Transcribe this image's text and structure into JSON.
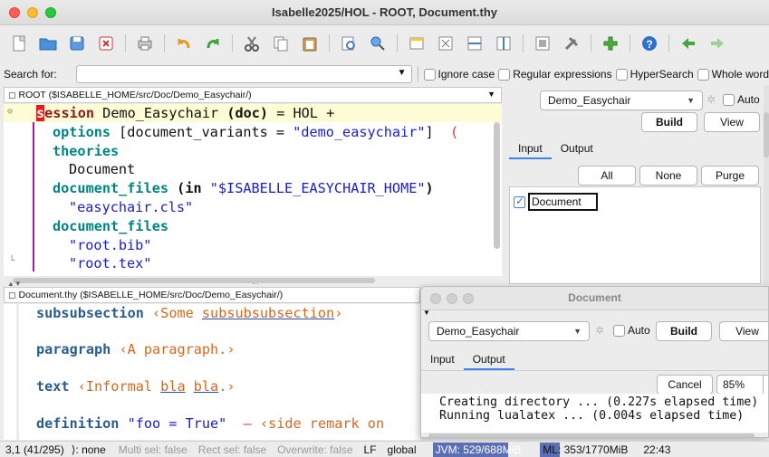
{
  "window": {
    "title": "Isabelle2025/HOL - ROOT, Document.thy"
  },
  "toolbar": {
    "icons": [
      "new-file-icon",
      "open-folder-icon",
      "save-icon",
      "close-icon",
      "print-icon",
      "undo-icon",
      "redo-icon",
      "cut-icon",
      "copy-icon",
      "paste-icon",
      "find-icon",
      "replace-icon",
      "new-view-icon",
      "split-icon",
      "split-horizontal-icon",
      "split-vertical-icon",
      "unsplit-icon",
      "options-icon",
      "plugin-icon",
      "help-icon",
      "back-icon",
      "forward-icon"
    ]
  },
  "search": {
    "label": "Search for:",
    "value": "",
    "ignore_case": "Ignore case",
    "regex": "Regular expressions",
    "hypersearch": "HyperSearch",
    "whole_word": "Whole word"
  },
  "top_editor": {
    "path": "ROOT ($ISABELLE_HOME/src/Doc/Demo_Easychair/)"
  },
  "bottom_editor": {
    "path": "Document.thy ($ISABELLE_HOME/src/Doc/Demo_Easychair/)"
  },
  "side_panel": {
    "session": "Demo_Easychair",
    "auto_label": "Auto",
    "build": "Build",
    "view": "View",
    "tabs": [
      "Input",
      "Output"
    ],
    "all": "All",
    "none": "None",
    "purge": "Purge",
    "items": [
      {
        "label": "Document",
        "checked": true
      }
    ]
  },
  "doc_window": {
    "title": "Document",
    "session": "Demo_Easychair",
    "auto_label": "Auto",
    "build": "Build",
    "view": "View",
    "tabs": [
      "Input",
      "Output"
    ],
    "cancel": "Cancel",
    "zoom": "85%",
    "console": [
      "Creating directory ... (0.227s elapsed time)",
      "Running lualatex ... (0.004s elapsed time)"
    ]
  },
  "status": {
    "position": "3,1 (41/295)",
    "mode": "⟩: none",
    "multi": "Multi sel: false",
    "rect": "Rect sel: false",
    "overwrite": "Overwrite: false",
    "lf": "LF",
    "global": "global",
    "jvm": "JVM: 529/688MiB",
    "ml": "ML: 353/1770MiB",
    "time": "22:43",
    "jvm_fraction": 0.77,
    "ml_fraction": 0.2
  }
}
